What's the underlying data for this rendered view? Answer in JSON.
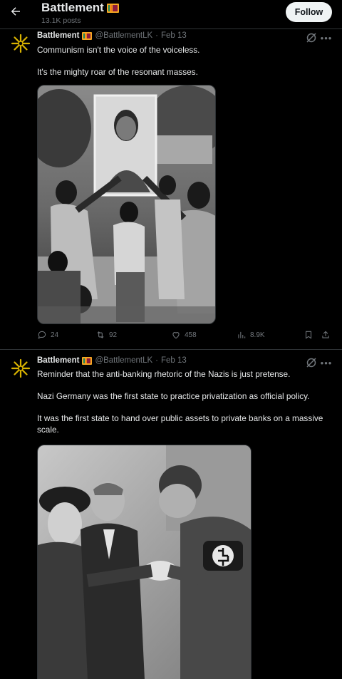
{
  "header": {
    "title": "Battlement",
    "posts_count": "13.1K posts",
    "follow_label": "Follow"
  },
  "tweets": [
    {
      "name": "Battlement",
      "handle": "@BattlementLK",
      "date": "Feb 13",
      "separator": "·",
      "paragraphs": [
        "Communism isn't the voice of the voiceless.",
        "It's the mighty roar of the resonant masses."
      ],
      "image_description": "Black-and-white photo of people raising a portrait poster",
      "stats": {
        "replies": "24",
        "reposts": "92",
        "likes": "458",
        "views": "8.9K"
      }
    },
    {
      "name": "Battlement",
      "handle": "@BattlementLK",
      "date": "Feb 13",
      "separator": "·",
      "paragraphs": [
        "Reminder that the anti-banking rhetoric of the Nazis is just pretense.",
        "Nazi Germany was the first state to practice privatization as official policy.",
        "It was the first state to hand over public assets to private banks on a massive scale."
      ],
      "image_description": "Black-and-white photo of people shaking hands"
    }
  ],
  "icons": {
    "back": "arrow-left-icon",
    "grok": "grok-icon",
    "more": "more-icon",
    "reply": "reply-icon",
    "repost": "repost-icon",
    "like": "heart-icon",
    "views": "views-icon",
    "bookmark": "bookmark-icon",
    "share": "share-icon"
  },
  "colors": {
    "background": "#000000",
    "text": "#e7e9ea",
    "muted": "#71767b",
    "divider": "#2f3336",
    "follow_bg": "#eff3f4",
    "avatar_gold": "#d9b300"
  }
}
